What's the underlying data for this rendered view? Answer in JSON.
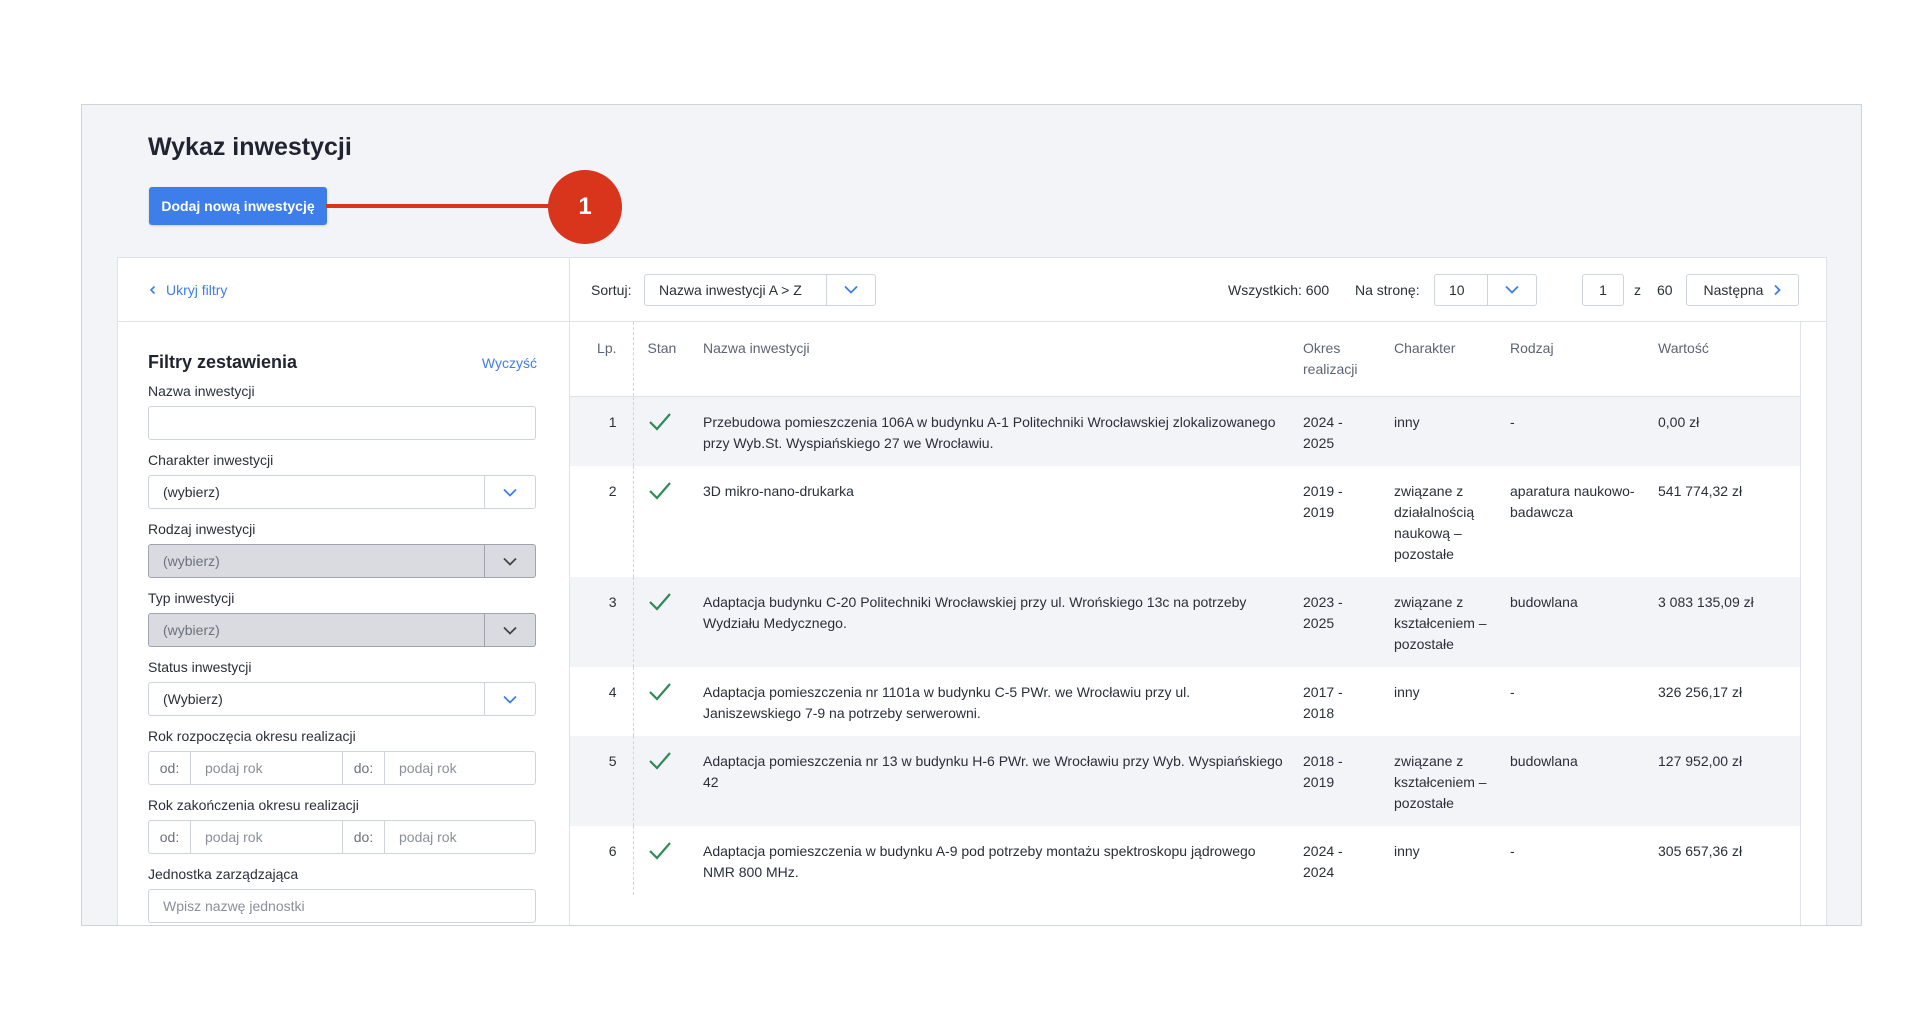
{
  "page": {
    "title": "Wykaz inwestycji",
    "add_button": "Dodaj nową inwestycję",
    "callout_number": "1"
  },
  "filters": {
    "hide_label": "Ukryj filtry",
    "title": "Filtry zestawienia",
    "clear_label": "Wyczyść",
    "name_label": "Nazwa inwestycji",
    "name_value": "",
    "character_label": "Charakter inwestycji",
    "character_value": "(wybierz)",
    "kind_label": "Rodzaj inwestycji",
    "kind_value": "(wybierz)",
    "type_label": "Typ inwestycji",
    "type_value": "(wybierz)",
    "status_label": "Status inwestycji",
    "status_value": "(Wybierz)",
    "start_year_label": "Rok rozpoczęcia okresu realizacji",
    "end_year_label": "Rok zakończenia okresu realizacji",
    "from_label": "od:",
    "to_label": "do:",
    "year_placeholder": "podaj rok",
    "unit_label": "Jednostka zarządzająca",
    "unit_placeholder": "Wpisz nazwę jednostki"
  },
  "toolbar": {
    "sort_label": "Sortuj:",
    "sort_value": "Nazwa inwestycji A > Z",
    "total_text": "Wszystkich: 600",
    "per_page_label": "Na stronę:",
    "per_page_value": "10",
    "current_page": "1",
    "of_label": "z",
    "total_pages": "60",
    "next_label": "Następna"
  },
  "table": {
    "headers": {
      "lp": "Lp.",
      "stan": "Stan",
      "name": "Nazwa inwestycji",
      "okres_1": "Okres",
      "okres_2": "realizacji",
      "charakter": "Charakter",
      "rodzaj": "Rodzaj",
      "wartosc": "Wartość"
    },
    "rows": [
      {
        "lp": "1",
        "name": "Przebudowa pomieszczenia 106A w budynku A-1 Politechniki Wrocławskiej zlokalizowanego przy Wyb.St. Wyspiańskiego 27 we Wrocławiu.",
        "okres": "2024 - 2025",
        "charakter": "inny",
        "rodzaj": "-",
        "wartosc": "0,00 zł"
      },
      {
        "lp": "2",
        "name": "3D mikro-nano-drukarka",
        "okres": "2019 - 2019",
        "charakter": "związane z działalnością naukową – pozostałe",
        "rodzaj": "aparatura naukowo-badawcza",
        "wartosc": "541 774,32 zł"
      },
      {
        "lp": "3",
        "name": "Adaptacja budynku C-20 Politechniki Wrocławskiej przy ul. Wrońskiego 13c na potrzeby Wydziału Medycznego.",
        "okres": "2023 - 2025",
        "charakter": "związane z kształceniem – pozostałe",
        "rodzaj": "budowlana",
        "wartosc": "3 083 135,09 zł"
      },
      {
        "lp": "4",
        "name": "Adaptacja pomieszczenia nr 1101a w budynku C-5 PWr. we Wrocławiu przy ul. Janiszewskiego 7-9 na potrzeby serwerowni.",
        "okres": "2017 - 2018",
        "charakter": "inny",
        "rodzaj": "-",
        "wartosc": "326 256,17 zł"
      },
      {
        "lp": "5",
        "name": "Adaptacja pomieszczenia nr 13 w budynku H-6 PWr. we Wrocławiu przy Wyb. Wyspiańskiego 42",
        "okres": "2018 - 2019",
        "charakter": "związane z kształceniem – pozostałe",
        "rodzaj": "budowlana",
        "wartosc": "127 952,00 zł"
      },
      {
        "lp": "6",
        "name": "Adaptacja pomieszczenia w budynku A-9 pod potrzeby montażu spektroskopu jądrowego NMR 800 MHz.",
        "okres": "2024 - 2024",
        "charakter": "inny",
        "rodzaj": "-",
        "wartosc": "305 657,36 zł"
      }
    ]
  },
  "colors": {
    "accent": "#3d7eea",
    "callout": "#d9341c",
    "status_ok": "#2e8b57"
  }
}
